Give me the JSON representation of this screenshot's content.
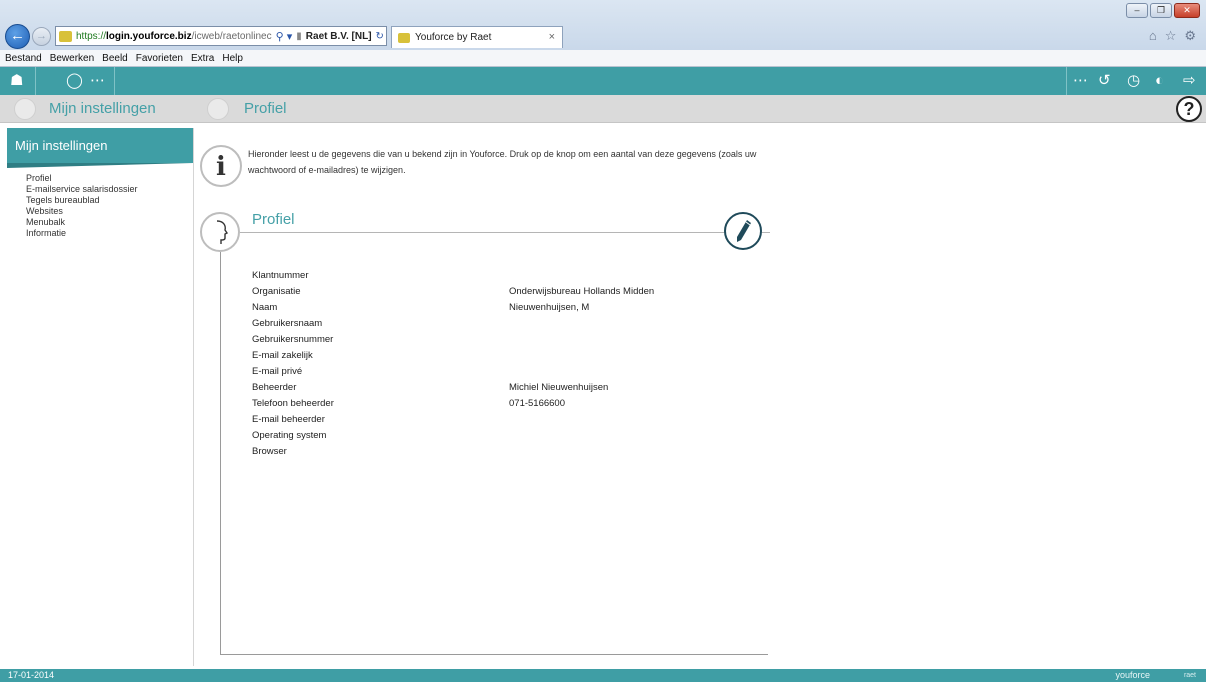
{
  "browser": {
    "address_https": "https://",
    "address_host": "login.youforce.biz",
    "address_path": "/icweb/raetonlinec",
    "cert_label": "Raet B.V. [NL]",
    "tab_title": "Youforce by Raet",
    "menu": [
      "Bestand",
      "Bewerken",
      "Beeld",
      "Favorieten",
      "Extra",
      "Help"
    ]
  },
  "subbar": {
    "section_title": "Mijn instellingen",
    "page_title": "Profiel"
  },
  "sidebar": {
    "header": "Mijn instellingen",
    "items": [
      {
        "label": "Profiel"
      },
      {
        "label": "E-mailservice salarisdossier"
      },
      {
        "label": "Tegels bureaublad"
      },
      {
        "label": "Websites"
      },
      {
        "label": "Menubalk"
      },
      {
        "label": "Informatie"
      }
    ]
  },
  "main": {
    "intro_line1": "Hieronder leest u de gegevens die van u bekend zijn in Youforce. Druk op de knop om een aantal van deze gegevens (zoals uw",
    "intro_line2": "wachtwoord of e-mailadres) te wijzigen.",
    "profile_title": "Profiel",
    "fields": [
      {
        "label": "Klantnummer",
        "value": ""
      },
      {
        "label": "Organisatie",
        "value": "Onderwijsbureau Hollands Midden"
      },
      {
        "label": "Naam",
        "value": "Nieuwenhuijsen, M"
      },
      {
        "label": "Gebruikersnaam",
        "value": ""
      },
      {
        "label": "Gebruikersnummer",
        "value": ""
      },
      {
        "label": "E-mail zakelijk",
        "value": ""
      },
      {
        "label": "E-mail privé",
        "value": ""
      },
      {
        "label": "Beheerder",
        "value": "Michiel Nieuwenhuijsen"
      },
      {
        "label": "Telefoon beheerder",
        "value": "071-5166600"
      },
      {
        "label": "E-mail beheerder",
        "value": ""
      },
      {
        "label": "Operating system",
        "value": ""
      },
      {
        "label": "Browser",
        "value": ""
      }
    ]
  },
  "statusbar": {
    "date": "17-01-2014",
    "brand": "youforce"
  },
  "colors": {
    "accent": "#3f9ea5",
    "accent_dark": "#2f7e84",
    "title_text": "#45a0a7"
  }
}
